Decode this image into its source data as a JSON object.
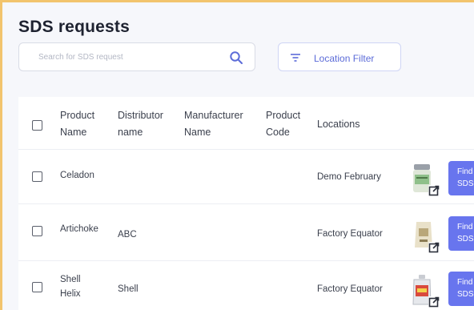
{
  "page": {
    "title": "SDS requests"
  },
  "search": {
    "placeholder": "Search for SDS request"
  },
  "filter": {
    "label": "Location Filter"
  },
  "table": {
    "headers": {
      "product_name": [
        "Product",
        "Name"
      ],
      "distributor_name": [
        "Distributor",
        "name"
      ],
      "manufacturer_name": [
        "Manufacturer",
        "Name"
      ],
      "product_code": [
        "Product",
        "Code"
      ],
      "locations": "Locations"
    },
    "rows": [
      {
        "product_name": [
          "Celadon"
        ],
        "distributor": "",
        "manufacturer": "",
        "code": "",
        "location": "Demo February",
        "thumb": "jar-icon",
        "action": [
          "Find",
          "SDS"
        ]
      },
      {
        "product_name": [
          "Artichoke"
        ],
        "distributor": "ABC",
        "manufacturer": "",
        "code": "",
        "location": "Factory Equator",
        "thumb": "bag-icon",
        "action": [
          "Find",
          "SDS"
        ]
      },
      {
        "product_name": [
          "Shell",
          "Helix"
        ],
        "distributor": "Shell",
        "manufacturer": "",
        "code": "",
        "location": "Factory Equator",
        "thumb": "oil-can-icon",
        "action": [
          "Find",
          "SDS"
        ]
      }
    ]
  },
  "colors": {
    "accent": "#6875ee",
    "frame": "#f2c46d",
    "background": "#f6f7fb"
  }
}
